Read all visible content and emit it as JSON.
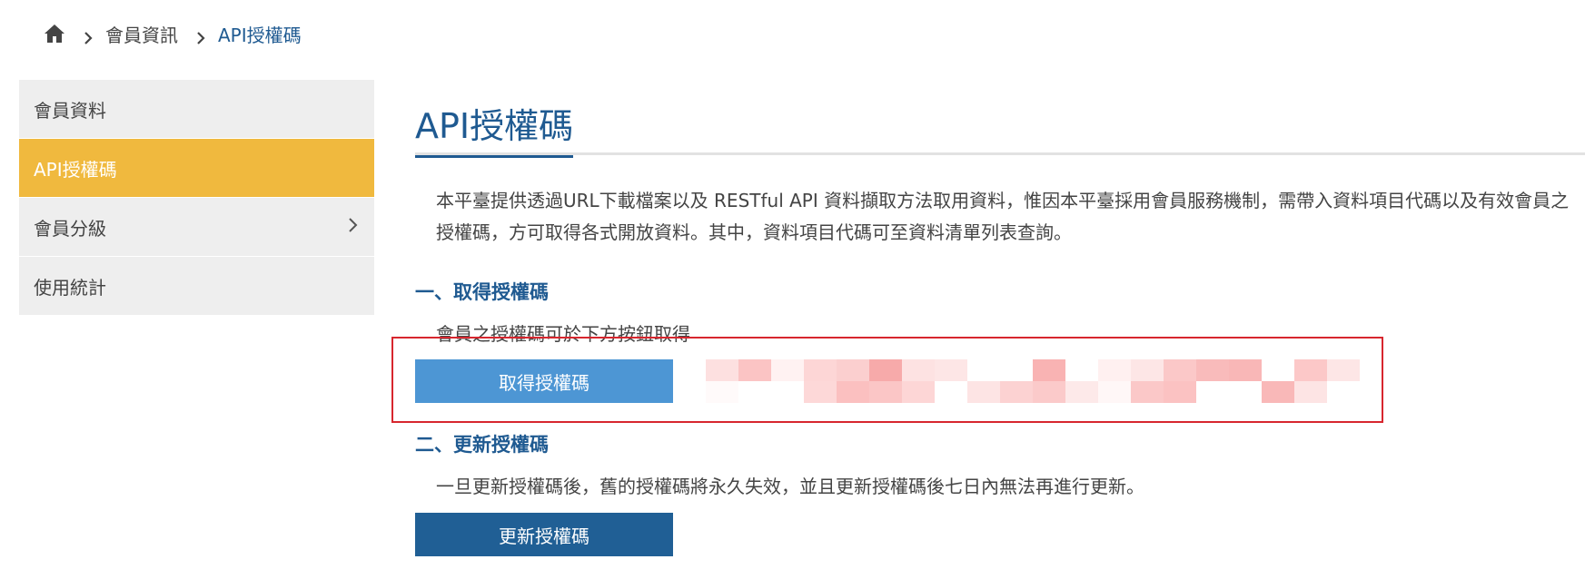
{
  "breadcrumb": {
    "home_icon": "home-icon",
    "items": [
      "會員資訊",
      "API授權碼"
    ]
  },
  "sidebar": {
    "items": [
      {
        "label": "會員資料",
        "active": false,
        "has_submenu": false
      },
      {
        "label": "API授權碼",
        "active": true,
        "has_submenu": false
      },
      {
        "label": "會員分級",
        "active": false,
        "has_submenu": true
      },
      {
        "label": "使用統計",
        "active": false,
        "has_submenu": false
      }
    ]
  },
  "main": {
    "title": "API授權碼",
    "intro": "本平臺提供透過URL下載檔案以及 RESTful API 資料擷取方法取用資料，惟因本平臺採用會員服務機制，需帶入資料項目代碼以及有效會員之授權碼，方可取得各式開放資料。其中，資料項目代碼可至資料清單列表查詢。",
    "section1": {
      "heading": "一、取得授權碼",
      "text": "會員之授權碼可於下方按鈕取得",
      "button": "取得授權碼"
    },
    "section2": {
      "heading": "二、更新授權碼",
      "text": "一旦更新授權碼後，舊的授權碼將永久失效，並且更新授權碼後七日內無法再進行更新。",
      "button": "更新授權碼"
    }
  },
  "colors": {
    "accent_blue": "#1f5a91",
    "active_menu": "#f0b93e",
    "button_get": "#4d96d4",
    "button_renew": "#205f95",
    "highlight_border": "#d7262e"
  }
}
